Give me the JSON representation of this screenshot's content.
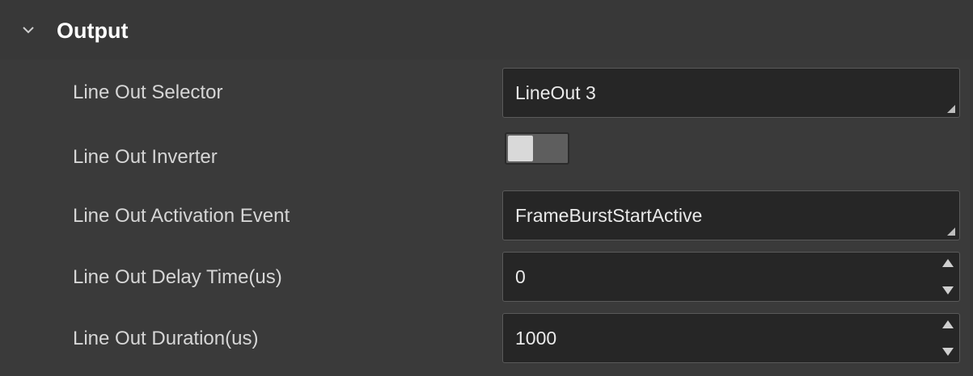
{
  "section": {
    "title": "Output",
    "expanded": true,
    "icon": "chevron-down-icon"
  },
  "rows": {
    "line_out_selector": {
      "label": "Line Out Selector",
      "value": "LineOut 3"
    },
    "line_out_inverter": {
      "label": "Line Out Inverter",
      "enabled": false
    },
    "line_out_activation_event": {
      "label": "Line Out Activation Event",
      "value": "FrameBurstStartActive"
    },
    "line_out_delay_time": {
      "label": "Line Out Delay Time(us)",
      "value": "0"
    },
    "line_out_duration": {
      "label": "Line Out Duration(us)",
      "value": "1000"
    }
  },
  "colors": {
    "panel_background": "#3a3a3a",
    "field_background": "#262626",
    "label_text": "#d6d6d6",
    "header_text": "#ffffff"
  }
}
